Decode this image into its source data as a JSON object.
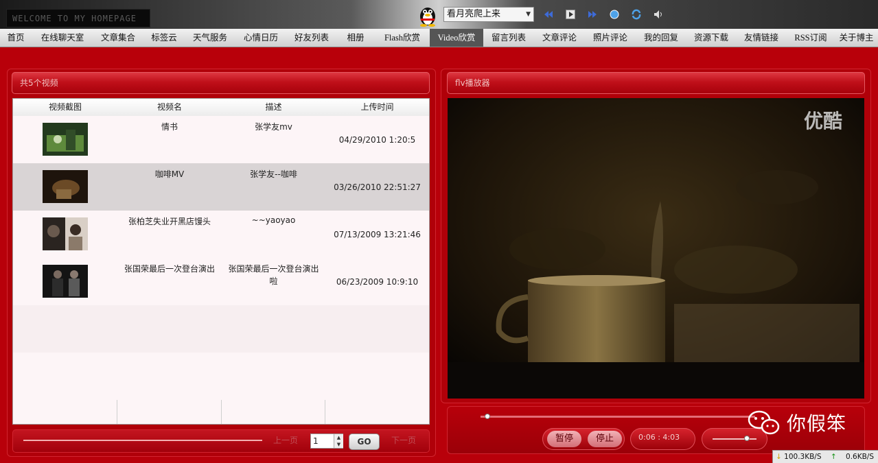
{
  "topbar": {
    "welcome": "WELCOME TO MY HOMEPAGE",
    "song": "看月亮爬上来"
  },
  "nav": [
    {
      "label": "首页"
    },
    {
      "label": "在线聊天室"
    },
    {
      "label": "文章集合"
    },
    {
      "label": "标签云"
    },
    {
      "label": "天气服务"
    },
    {
      "label": "心情日历"
    },
    {
      "label": "好友列表"
    },
    {
      "label": "相册"
    },
    {
      "label": "Flash欣赏"
    },
    {
      "label": "Video欣赏",
      "active": true
    },
    {
      "label": "留言列表"
    },
    {
      "label": "文章评论"
    },
    {
      "label": "照片评论"
    },
    {
      "label": "我的回复"
    },
    {
      "label": "资源下载"
    },
    {
      "label": "友情链接"
    },
    {
      "label": "RSS订阅"
    },
    {
      "label": "关于博主"
    }
  ],
  "list_panel": {
    "title": "共5个视频",
    "headers": [
      "视频截图",
      "视频名",
      "描述",
      "上传时间"
    ],
    "rows": [
      {
        "name": "情书",
        "desc": "张学友mv",
        "time": "04/29/2010  1:20:5"
      },
      {
        "name": "咖啡MV",
        "desc": "张学友--咖啡",
        "time": "03/26/2010  22:51:27"
      },
      {
        "name": "张柏芝失业开黑店馒头",
        "desc": "~~yaoyao",
        "time": "07/13/2009  13:21:46"
      },
      {
        "name": "张国荣最后一次登台演出",
        "desc": "张国荣最后一次登台演出啦",
        "time": "06/23/2009  10:9:10"
      }
    ],
    "pager": {
      "prev": "上一页",
      "page": "1",
      "go": "GO",
      "next": "下一页"
    }
  },
  "player_panel": {
    "title": "flv播放器",
    "watermark": "优酷",
    "pause": "暂停",
    "stop": "停止",
    "time": "0:06 : 4:03",
    "progress_fraction": 0.025,
    "volume_fraction": 0.75
  },
  "overlay_watermark": "你假笨",
  "statusbar": {
    "down": "100.3KB/S",
    "up": "0.6KB/S"
  },
  "colors": {
    "theme_red": "#b8000a",
    "nav_active": "#555555"
  }
}
